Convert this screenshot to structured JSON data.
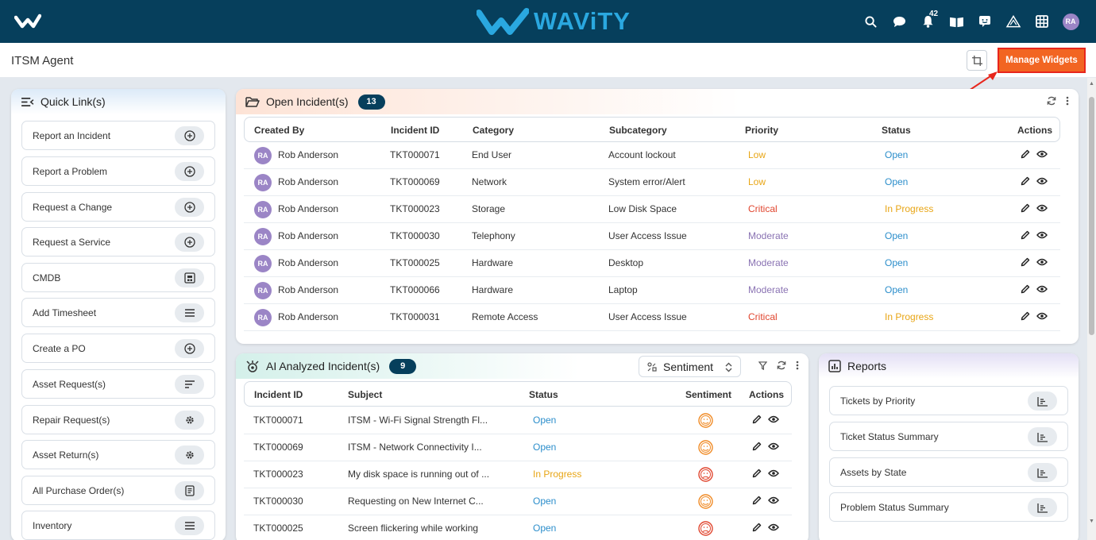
{
  "header": {
    "brand": "WAViTY",
    "notification_count": "42",
    "user_initials": "RA"
  },
  "subheader": {
    "title": "ITSM Agent",
    "manage_widgets_label": "Manage Widgets"
  },
  "quick_links": {
    "title": "Quick Link(s)",
    "items": [
      {
        "label": "Report an Incident",
        "icon": "plus-circle-icon"
      },
      {
        "label": "Report a Problem",
        "icon": "plus-circle-icon"
      },
      {
        "label": "Request a Change",
        "icon": "plus-circle-icon"
      },
      {
        "label": "Request a Service",
        "icon": "plus-circle-icon"
      },
      {
        "label": "CMDB",
        "icon": "cmdb-icon"
      },
      {
        "label": "Add Timesheet",
        "icon": "list-icon"
      },
      {
        "label": "Create a PO",
        "icon": "plus-circle-icon"
      },
      {
        "label": "Asset Request(s)",
        "icon": "filter-lines-icon"
      },
      {
        "label": "Repair Request(s)",
        "icon": "gear-icon"
      },
      {
        "label": "Asset Return(s)",
        "icon": "gear-icon"
      },
      {
        "label": "All Purchase Order(s)",
        "icon": "document-icon"
      },
      {
        "label": "Inventory",
        "icon": "list-icon"
      }
    ]
  },
  "open_incidents": {
    "title": "Open Incident(s)",
    "count": "13",
    "columns": [
      "Created By",
      "Incident ID",
      "Category",
      "Subcategory",
      "Priority",
      "Status",
      "Actions"
    ],
    "rows": [
      {
        "initials": "RA",
        "created_by": "Rob Anderson",
        "id": "TKT000071",
        "category": "End User",
        "subcategory": "Account lockout",
        "priority": "Low",
        "status": "Open"
      },
      {
        "initials": "RA",
        "created_by": "Rob Anderson",
        "id": "TKT000069",
        "category": "Network",
        "subcategory": "System error/Alert",
        "priority": "Low",
        "status": "Open"
      },
      {
        "initials": "RA",
        "created_by": "Rob Anderson",
        "id": "TKT000023",
        "category": "Storage",
        "subcategory": "Low Disk Space",
        "priority": "Critical",
        "status": "In Progress"
      },
      {
        "initials": "RA",
        "created_by": "Rob Anderson",
        "id": "TKT000030",
        "category": "Telephony",
        "subcategory": "User Access Issue",
        "priority": "Moderate",
        "status": "Open"
      },
      {
        "initials": "RA",
        "created_by": "Rob Anderson",
        "id": "TKT000025",
        "category": "Hardware",
        "subcategory": "Desktop",
        "priority": "Moderate",
        "status": "Open"
      },
      {
        "initials": "RA",
        "created_by": "Rob Anderson",
        "id": "TKT000066",
        "category": "Hardware",
        "subcategory": "Laptop",
        "priority": "Moderate",
        "status": "Open"
      },
      {
        "initials": "RA",
        "created_by": "Rob Anderson",
        "id": "TKT000031",
        "category": "Remote Access",
        "subcategory": "User Access Issue",
        "priority": "Critical",
        "status": "In Progress"
      }
    ]
  },
  "ai_incidents": {
    "title": "AI Analyzed Incident(s)",
    "count": "9",
    "sort_label": "Sentiment",
    "columns": [
      "Incident ID",
      "Subject",
      "Status",
      "Sentiment",
      "Actions"
    ],
    "rows": [
      {
        "id": "TKT000071",
        "subject": "ITSM - Wi-Fi Signal Strength Fl...",
        "status": "Open",
        "sentiment": "neutral"
      },
      {
        "id": "TKT000069",
        "subject": "ITSM - Network Connectivity I...",
        "status": "Open",
        "sentiment": "neutral"
      },
      {
        "id": "TKT000023",
        "subject": "My disk space is running out of ...",
        "status": "In Progress",
        "sentiment": "negative"
      },
      {
        "id": "TKT000030",
        "subject": "Requesting on New Internet C...",
        "status": "Open",
        "sentiment": "neutral"
      },
      {
        "id": "TKT000025",
        "subject": "Screen flickering while working",
        "status": "Open",
        "sentiment": "negative"
      }
    ]
  },
  "reports": {
    "title": "Reports",
    "items": [
      "Tickets by Priority",
      "Ticket Status Summary",
      "Assets by State",
      "Problem Status Summary"
    ]
  },
  "colors": {
    "header_bg": "#063f5c",
    "accent_orange": "#f26522",
    "priority_low": "#e8a514",
    "priority_critical": "#e0452e",
    "priority_moderate": "#8a73b3",
    "status_open": "#2c8ecb"
  }
}
